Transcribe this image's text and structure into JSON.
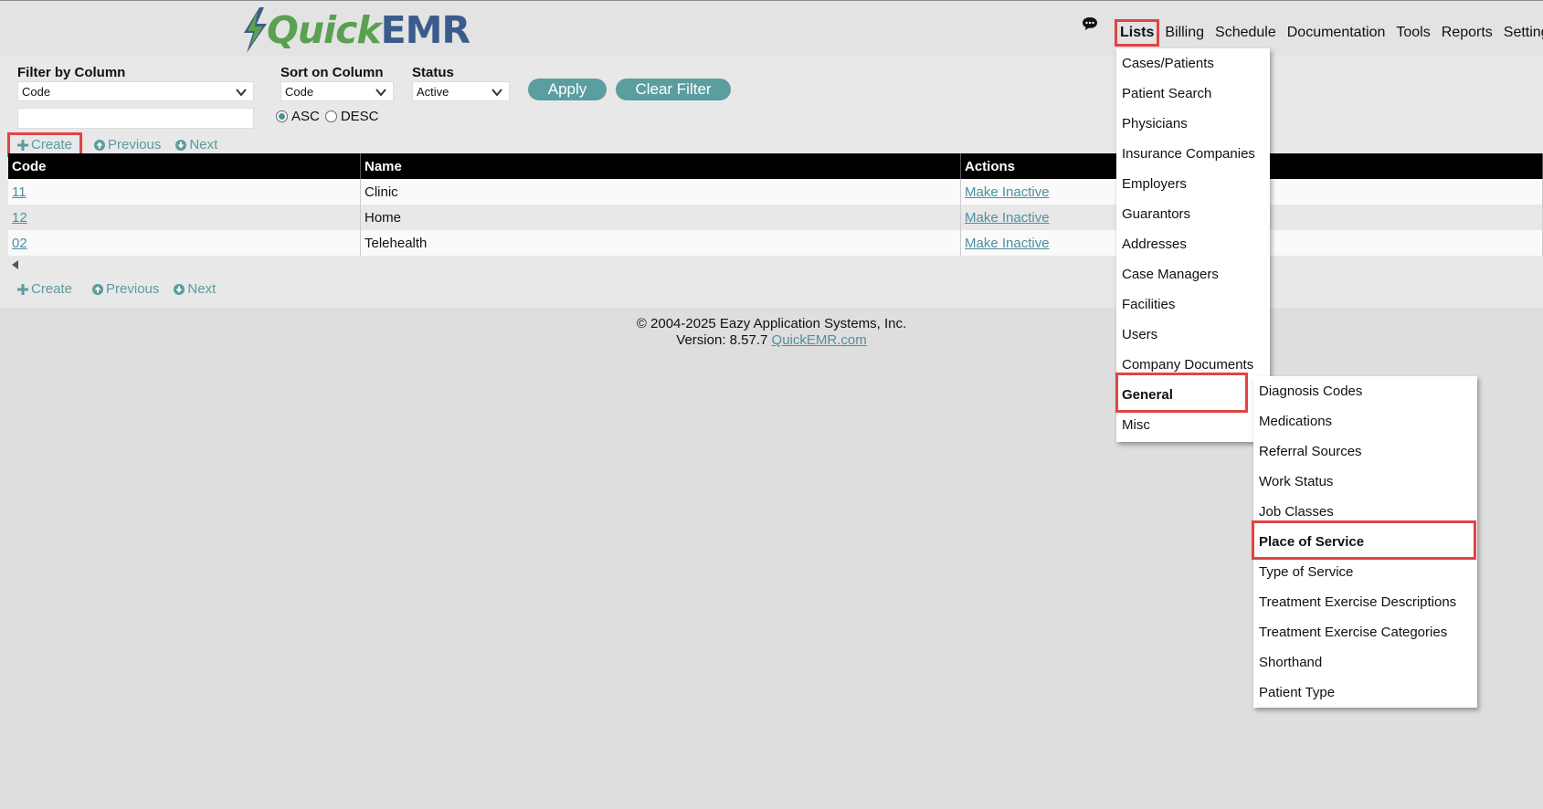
{
  "brand": {
    "part1": "Quick",
    "part2": "EMR"
  },
  "nav": {
    "items": [
      "Lists",
      "Billing",
      "Schedule",
      "Documentation",
      "Tools",
      "Reports",
      "Settings"
    ],
    "active": "Lists"
  },
  "filter": {
    "filter_label": "Filter by Column",
    "filter_value": "Code",
    "sort_label": "Sort on Column",
    "sort_value": "Code",
    "status_label": "Status",
    "status_value": "Active",
    "text_value": "",
    "asc_label": "ASC",
    "desc_label": "DESC",
    "order_selected": "ASC",
    "apply_label": "Apply",
    "clear_label": "Clear Filter"
  },
  "toolbar": {
    "create_label": "Create",
    "previous_label": "Previous",
    "next_label": "Next"
  },
  "table": {
    "columns": [
      "Code",
      "Name",
      "Actions"
    ],
    "rows": [
      {
        "code": "11",
        "name": "Clinic",
        "action": "Make Inactive"
      },
      {
        "code": "12",
        "name": "Home",
        "action": "Make Inactive"
      },
      {
        "code": "02",
        "name": "Telehealth",
        "action": "Make Inactive"
      }
    ]
  },
  "footer": {
    "copyright": "© 2004-2025 Eazy Application Systems, Inc.",
    "version_prefix": "Version: 8.57.7",
    "site_link": "QuickEMR.com"
  },
  "lists_menu": {
    "items": [
      "Cases/Patients",
      "Patient Search",
      "Physicians",
      "Insurance Companies",
      "Employers",
      "Guarantors",
      "Addresses",
      "Case Managers",
      "Facilities",
      "Users",
      "Company Documents",
      "General",
      "Misc"
    ],
    "highlighted": "General"
  },
  "general_submenu": {
    "items": [
      "Diagnosis Codes",
      "Medications",
      "Referral Sources",
      "Work Status",
      "Job Classes",
      "Place of Service",
      "Type of Service",
      "Treatment Exercise Descriptions",
      "Treatment Exercise Categories",
      "Shorthand",
      "Patient Type"
    ],
    "highlighted": "Place of Service"
  },
  "icons": {
    "chat": "chat-bubble-icon",
    "bolt": "lightning-bolt-icon",
    "plus": "plus-icon",
    "prev": "circle-up-arrow-icon",
    "next": "circle-down-arrow-icon"
  },
  "colors": {
    "accent": "#5b9ea0",
    "link": "#4e8fa0",
    "highlight": "#e04444",
    "logo_green": "#5aa051",
    "logo_blue": "#3a5c8c"
  }
}
